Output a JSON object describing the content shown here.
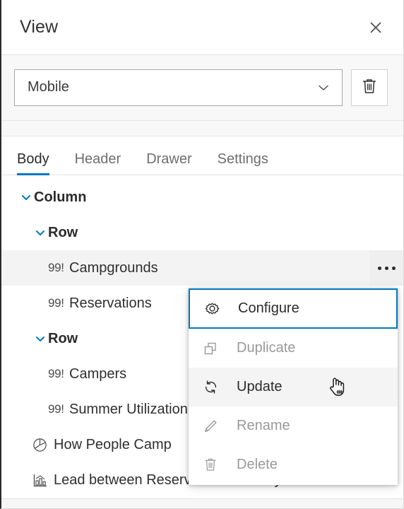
{
  "header": {
    "title": "View",
    "close_icon": "close-icon"
  },
  "view_selector": {
    "value": "Mobile",
    "chevron_icon": "chevron-down-icon",
    "delete_icon": "trash-icon"
  },
  "tabs": [
    {
      "label": "Body",
      "active": true
    },
    {
      "label": "Header",
      "active": false
    },
    {
      "label": "Drawer",
      "active": false
    },
    {
      "label": "Settings",
      "active": false
    }
  ],
  "tree": [
    {
      "label": "Column",
      "level": 0,
      "type": "group",
      "icon": "chevron-down-icon",
      "expanded": true,
      "selected": false,
      "actions": false
    },
    {
      "label": "Row",
      "level": 1,
      "type": "group",
      "icon": "chevron-down-icon",
      "expanded": true,
      "selected": false,
      "actions": false
    },
    {
      "label": "Campgrounds",
      "level": 2,
      "type": "widget",
      "icon": "number-99-icon",
      "selected": true,
      "actions": true
    },
    {
      "label": "Reservations",
      "level": 2,
      "type": "widget",
      "icon": "number-99-icon",
      "selected": false,
      "actions": false
    },
    {
      "label": "Row",
      "level": 1,
      "type": "group",
      "icon": "chevron-down-icon",
      "expanded": true,
      "selected": false,
      "actions": false
    },
    {
      "label": "Campers",
      "level": 2,
      "type": "widget",
      "icon": "number-99-icon",
      "selected": false,
      "actions": false
    },
    {
      "label": "Summer Utilization",
      "level": 2,
      "type": "widget",
      "icon": "number-99-icon",
      "selected": false,
      "actions": false
    },
    {
      "label": "How People Camp",
      "level": 1,
      "type": "chart",
      "icon": "pie-chart-icon",
      "selected": false,
      "actions": false
    },
    {
      "label": "Lead between Reservation and Stay",
      "level": 1,
      "type": "chart",
      "icon": "bar-chart-icon",
      "selected": false,
      "actions": false
    }
  ],
  "row_actions": {
    "more_icon": "more-dots-icon"
  },
  "context_menu": {
    "items": [
      {
        "label": "Configure",
        "icon": "gear-icon",
        "enabled": true,
        "focused": true,
        "hovered": false
      },
      {
        "label": "Duplicate",
        "icon": "duplicate-icon",
        "enabled": false,
        "focused": false,
        "hovered": false
      },
      {
        "label": "Update",
        "icon": "refresh-icon",
        "enabled": true,
        "focused": false,
        "hovered": true
      },
      {
        "label": "Rename",
        "icon": "pencil-icon",
        "enabled": false,
        "focused": false,
        "hovered": false
      },
      {
        "label": "Delete",
        "icon": "trash-icon",
        "enabled": false,
        "focused": false,
        "hovered": false
      }
    ],
    "cursor": "pointing-hand-cursor"
  },
  "colors": {
    "accent": "#0079c1",
    "text": "#2b2b2b",
    "muted": "#9a9a9a",
    "selected_row_bg": "#f3f3f3",
    "band_bg": "#f8f8f8"
  }
}
